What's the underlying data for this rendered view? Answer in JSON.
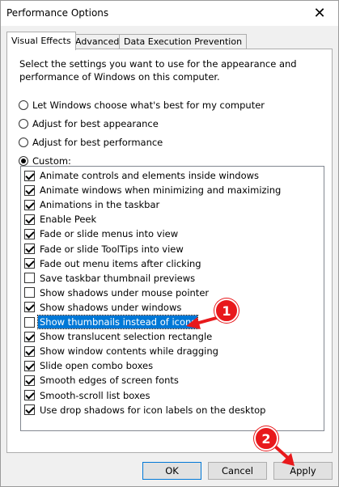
{
  "window": {
    "title": "Performance Options",
    "close_glyph": "✕"
  },
  "tabs": [
    {
      "label": "Visual Effects",
      "active": true
    },
    {
      "label": "Advanced",
      "active": false
    },
    {
      "label": "Data Execution Prevention",
      "active": false
    }
  ],
  "description": "Select the settings you want to use for the appearance and performance of Windows on this computer.",
  "radios": [
    {
      "label": "Let Windows choose what's best for my computer",
      "selected": false
    },
    {
      "label": "Adjust for best appearance",
      "selected": false
    },
    {
      "label": "Adjust for best performance",
      "selected": false
    },
    {
      "label": "Custom:",
      "selected": true
    }
  ],
  "effects": [
    {
      "label": "Animate controls and elements inside windows",
      "checked": true
    },
    {
      "label": "Animate windows when minimizing and maximizing",
      "checked": true
    },
    {
      "label": "Animations in the taskbar",
      "checked": true
    },
    {
      "label": "Enable Peek",
      "checked": true
    },
    {
      "label": "Fade or slide menus into view",
      "checked": true
    },
    {
      "label": "Fade or slide ToolTips into view",
      "checked": true
    },
    {
      "label": "Fade out menu items after clicking",
      "checked": true
    },
    {
      "label": "Save taskbar thumbnail previews",
      "checked": false
    },
    {
      "label": "Show shadows under mouse pointer",
      "checked": false
    },
    {
      "label": "Show shadows under windows",
      "checked": true
    },
    {
      "label": "Show thumbnails instead of icons",
      "checked": false,
      "selected": true
    },
    {
      "label": "Show translucent selection rectangle",
      "checked": true
    },
    {
      "label": "Show window contents while dragging",
      "checked": true
    },
    {
      "label": "Slide open combo boxes",
      "checked": true
    },
    {
      "label": "Smooth edges of screen fonts",
      "checked": true
    },
    {
      "label": "Smooth-scroll list boxes",
      "checked": true
    },
    {
      "label": "Use drop shadows for icon labels on the desktop",
      "checked": true
    }
  ],
  "buttons": {
    "ok": "OK",
    "cancel": "Cancel",
    "apply": "Apply"
  },
  "annotations": {
    "badge1": "1",
    "badge2": "2",
    "color": "#e8191c"
  }
}
